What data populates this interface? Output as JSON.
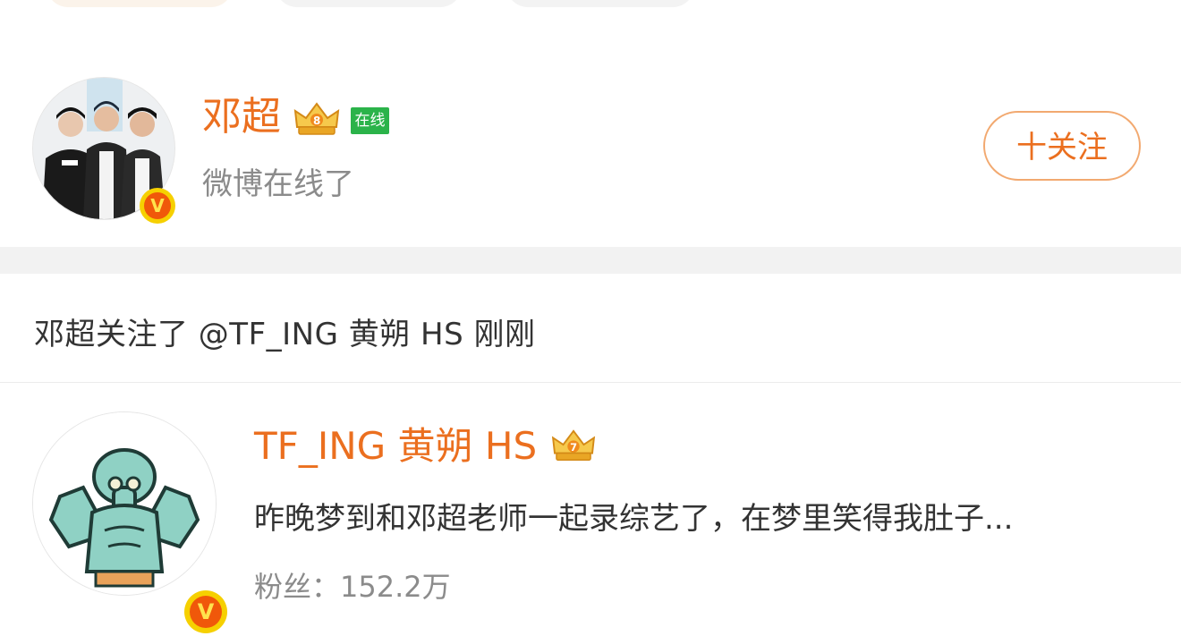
{
  "user_card": {
    "name": "邓超",
    "online_label": "在线",
    "subtitle": "微博在线了",
    "follow_label": "十关注",
    "verified_badge": "V",
    "crown_icon": "vip-crown-icon"
  },
  "activity": {
    "text": "邓超关注了 @TF_ING 黄朔 HS 刚刚"
  },
  "followed_user": {
    "name": "TF_ING 黄朔 HS",
    "description": "昨晚梦到和邓超老师一起录综艺了，在梦里笑得我肚子...",
    "fans_label": "粉丝：",
    "fans_count": "152.2万",
    "verified_badge": "V",
    "crown_icon": "vip-crown-icon"
  },
  "colors": {
    "accent": "#eb6f1f",
    "online_green": "#2bb34a",
    "verified_yellow": "#f6d000",
    "verified_orange": "#f0580a",
    "separator": "#f2f2f2"
  }
}
